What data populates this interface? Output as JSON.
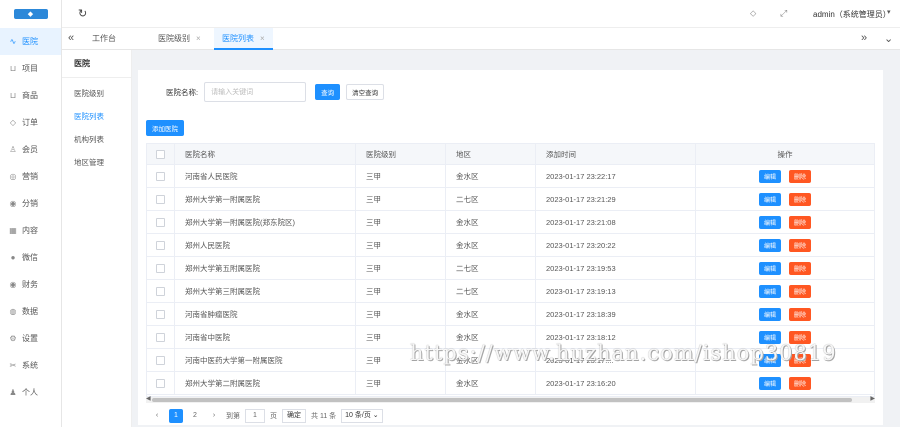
{
  "logo": {
    "text": "◆"
  },
  "sidebar": {
    "items": [
      {
        "label": "医院",
        "icon": "∿",
        "active": true
      },
      {
        "label": "项目",
        "icon": "⊔"
      },
      {
        "label": "商品",
        "icon": "⊔"
      },
      {
        "label": "订单",
        "icon": "◇"
      },
      {
        "label": "会员",
        "icon": "♙"
      },
      {
        "label": "营销",
        "icon": "◎"
      },
      {
        "label": "分销",
        "icon": "◉"
      },
      {
        "label": "内容",
        "icon": "▦"
      },
      {
        "label": "微信",
        "icon": "●"
      },
      {
        "label": "财务",
        "icon": "◉"
      },
      {
        "label": "数据",
        "icon": "◍"
      },
      {
        "label": "设置",
        "icon": "⚙"
      },
      {
        "label": "系统",
        "icon": "✂"
      },
      {
        "label": "个人",
        "icon": "♟"
      }
    ]
  },
  "header": {
    "refresh_icon": "↻",
    "tag_icon": "⬦",
    "fullscreen_icon": "⤢",
    "user": "admin（系统管理员）",
    "caret": "▾"
  },
  "tabs": {
    "back_icon": "«",
    "items": [
      {
        "label": "工作台",
        "closable": false
      },
      {
        "label": "医院级别",
        "closable": true
      },
      {
        "label": "医院列表",
        "closable": true,
        "active": true
      }
    ],
    "close_glyph": "×",
    "forward_icon": "»",
    "more_icon": "⌄"
  },
  "submenu": {
    "title": "医院",
    "items": [
      "医院级别",
      "医院列表",
      "机构列表",
      "地区管理"
    ],
    "active_index": 1
  },
  "search": {
    "label": "医院名称:",
    "placeholder": "请输入关键词",
    "query_btn": "查询",
    "clear_btn": "清空查询"
  },
  "add_btn": "添加医院",
  "table": {
    "headers": [
      "医院名称",
      "医院级别",
      "地区",
      "添加时间",
      "操作"
    ],
    "edit_label": "编辑",
    "delete_label": "删除",
    "rows": [
      {
        "name": "河南省人民医院",
        "level": "三甲",
        "region": "金水区",
        "time": "2023-01-17 23:22:17"
      },
      {
        "name": "郑州大学第一附属医院",
        "level": "三甲",
        "region": "二七区",
        "time": "2023-01-17 23:21:29"
      },
      {
        "name": "郑州大学第一附属医院(郑东院区)",
        "level": "三甲",
        "region": "金水区",
        "time": "2023-01-17 23:21:08"
      },
      {
        "name": "郑州人民医院",
        "level": "三甲",
        "region": "金水区",
        "time": "2023-01-17 23:20:22"
      },
      {
        "name": "郑州大学第五附属医院",
        "level": "三甲",
        "region": "二七区",
        "time": "2023-01-17 23:19:53"
      },
      {
        "name": "郑州大学第三附属医院",
        "level": "三甲",
        "region": "二七区",
        "time": "2023-01-17 23:19:13"
      },
      {
        "name": "河南省肿瘤医院",
        "level": "三甲",
        "region": "金水区",
        "time": "2023-01-17 23:18:39"
      },
      {
        "name": "河南省中医院",
        "level": "三甲",
        "region": "金水区",
        "time": "2023-01-17 23:18:12"
      },
      {
        "name": "河南中医药大学第一附属医院",
        "level": "三甲",
        "region": "金水区",
        "time": "2023-01-17 23:17:..."
      },
      {
        "name": "郑州大学第二附属医院",
        "level": "三甲",
        "region": "金水区",
        "time": "2023-01-17 23:16:20"
      }
    ]
  },
  "pagination": {
    "prev": "‹",
    "pages": [
      "1",
      "2"
    ],
    "current": "1",
    "next": "›",
    "goto_label": "到第",
    "goto_value": "1",
    "page_unit": "页",
    "confirm": "确定",
    "total": "共 11 条",
    "page_size": "10 条/页 ⌄"
  },
  "watermark": "https://www.huzhan.com/ishop30819",
  "colors": {
    "primary": "#1e90ff",
    "danger": "#ff5722"
  }
}
